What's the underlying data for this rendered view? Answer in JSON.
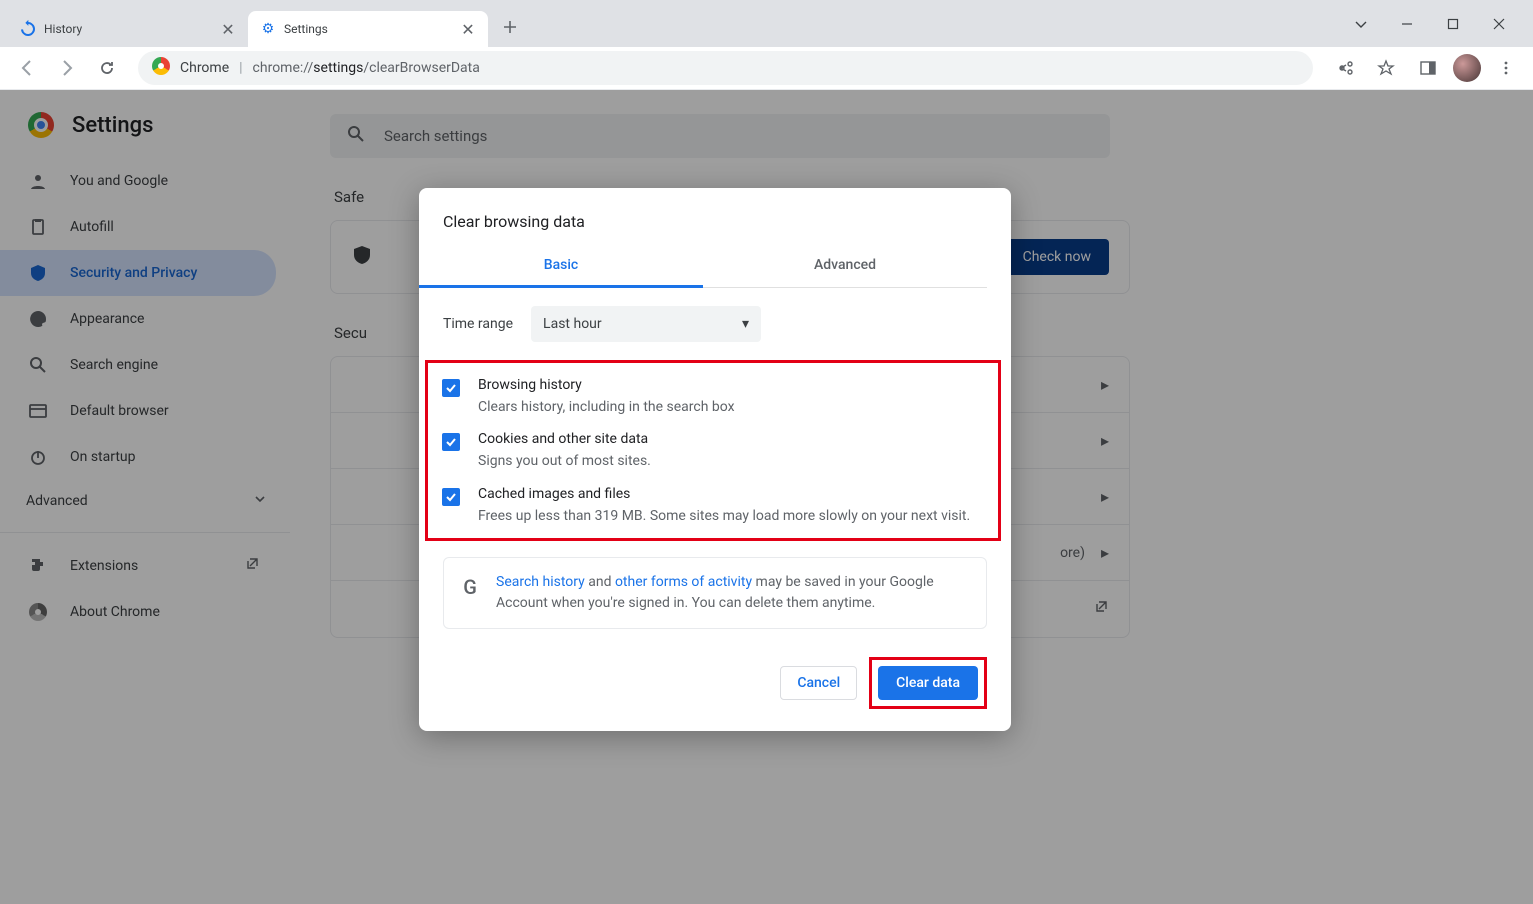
{
  "browser": {
    "tabs": [
      {
        "title": "History"
      },
      {
        "title": "Settings"
      }
    ],
    "url_prefix": "Chrome",
    "url_path_gray1": "chrome://",
    "url_path_dark": "settings",
    "url_path_gray2": "/clearBrowserData"
  },
  "page": {
    "title": "Settings",
    "search_placeholder": "Search settings",
    "sidebar": [
      {
        "label": "You and Google"
      },
      {
        "label": "Autofill"
      },
      {
        "label": "Security and Privacy"
      },
      {
        "label": "Appearance"
      },
      {
        "label": "Search engine"
      },
      {
        "label": "Default browser"
      },
      {
        "label": "On startup"
      }
    ],
    "advanced_label": "Advanced",
    "extensions_label": "Extensions",
    "about_label": "About Chrome",
    "safety_header": "Safe",
    "check_now": "Check now",
    "security_header_partial": "Secu",
    "more_text": "ore)"
  },
  "dialog": {
    "title": "Clear browsing data",
    "tabs": {
      "basic": "Basic",
      "advanced": "Advanced"
    },
    "time_label": "Time range",
    "time_value": "Last hour",
    "items": [
      {
        "title": "Browsing history",
        "sub": "Clears history, including in the search box"
      },
      {
        "title": "Cookies and other site data",
        "sub": "Signs you out of most sites."
      },
      {
        "title": "Cached images and files",
        "sub": "Frees up less than 319 MB. Some sites may load more slowly on your next visit."
      }
    ],
    "info": {
      "link1": "Search history",
      "mid": " and ",
      "link2": "other forms of activity",
      "rest": " may be saved in your Google Account when you're signed in. You can delete them anytime."
    },
    "cancel": "Cancel",
    "clear": "Clear data"
  }
}
